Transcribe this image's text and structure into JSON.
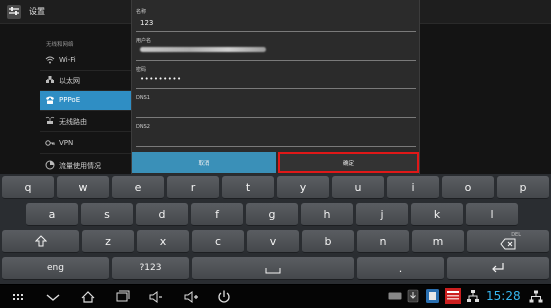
{
  "window": {
    "title": "设置"
  },
  "sidebar": {
    "section": "无线和网络",
    "items": [
      {
        "label": "Wi-Fi",
        "icon": "wifi-icon"
      },
      {
        "label": "以太网",
        "icon": "ethernet-icon"
      },
      {
        "label": "PPPoE",
        "icon": "phone-icon",
        "active": true
      },
      {
        "label": "无线路由",
        "icon": "router-icon"
      },
      {
        "label": "VPN",
        "icon": "vpn-key-icon"
      },
      {
        "label": "流量使用情况",
        "icon": "data-usage-icon"
      }
    ]
  },
  "dialog": {
    "fields": [
      {
        "label": "名称",
        "value": "123"
      },
      {
        "label": "用户名",
        "value": ""
      },
      {
        "label": "密码",
        "value": "•••••••••"
      },
      {
        "label": "DNS1",
        "value": ""
      },
      {
        "label": "DNS2",
        "value": ""
      }
    ],
    "cancel_label": "取消",
    "ok_label": "确定"
  },
  "keyboard": {
    "row1": [
      "q",
      "w",
      "e",
      "r",
      "t",
      "y",
      "u",
      "i",
      "o",
      "p"
    ],
    "row2": [
      "a",
      "s",
      "d",
      "f",
      "g",
      "h",
      "j",
      "k",
      "l"
    ],
    "row3": [
      "z",
      "x",
      "c",
      "v",
      "b",
      "n",
      "m"
    ],
    "del_label": "DEL",
    "lang_label": "eng",
    "symbols_label": "?123",
    "period_label": "."
  },
  "status": {
    "clock": "15:28",
    "accent_color": "#36b6f0",
    "ok_border_color": "#e01818"
  }
}
